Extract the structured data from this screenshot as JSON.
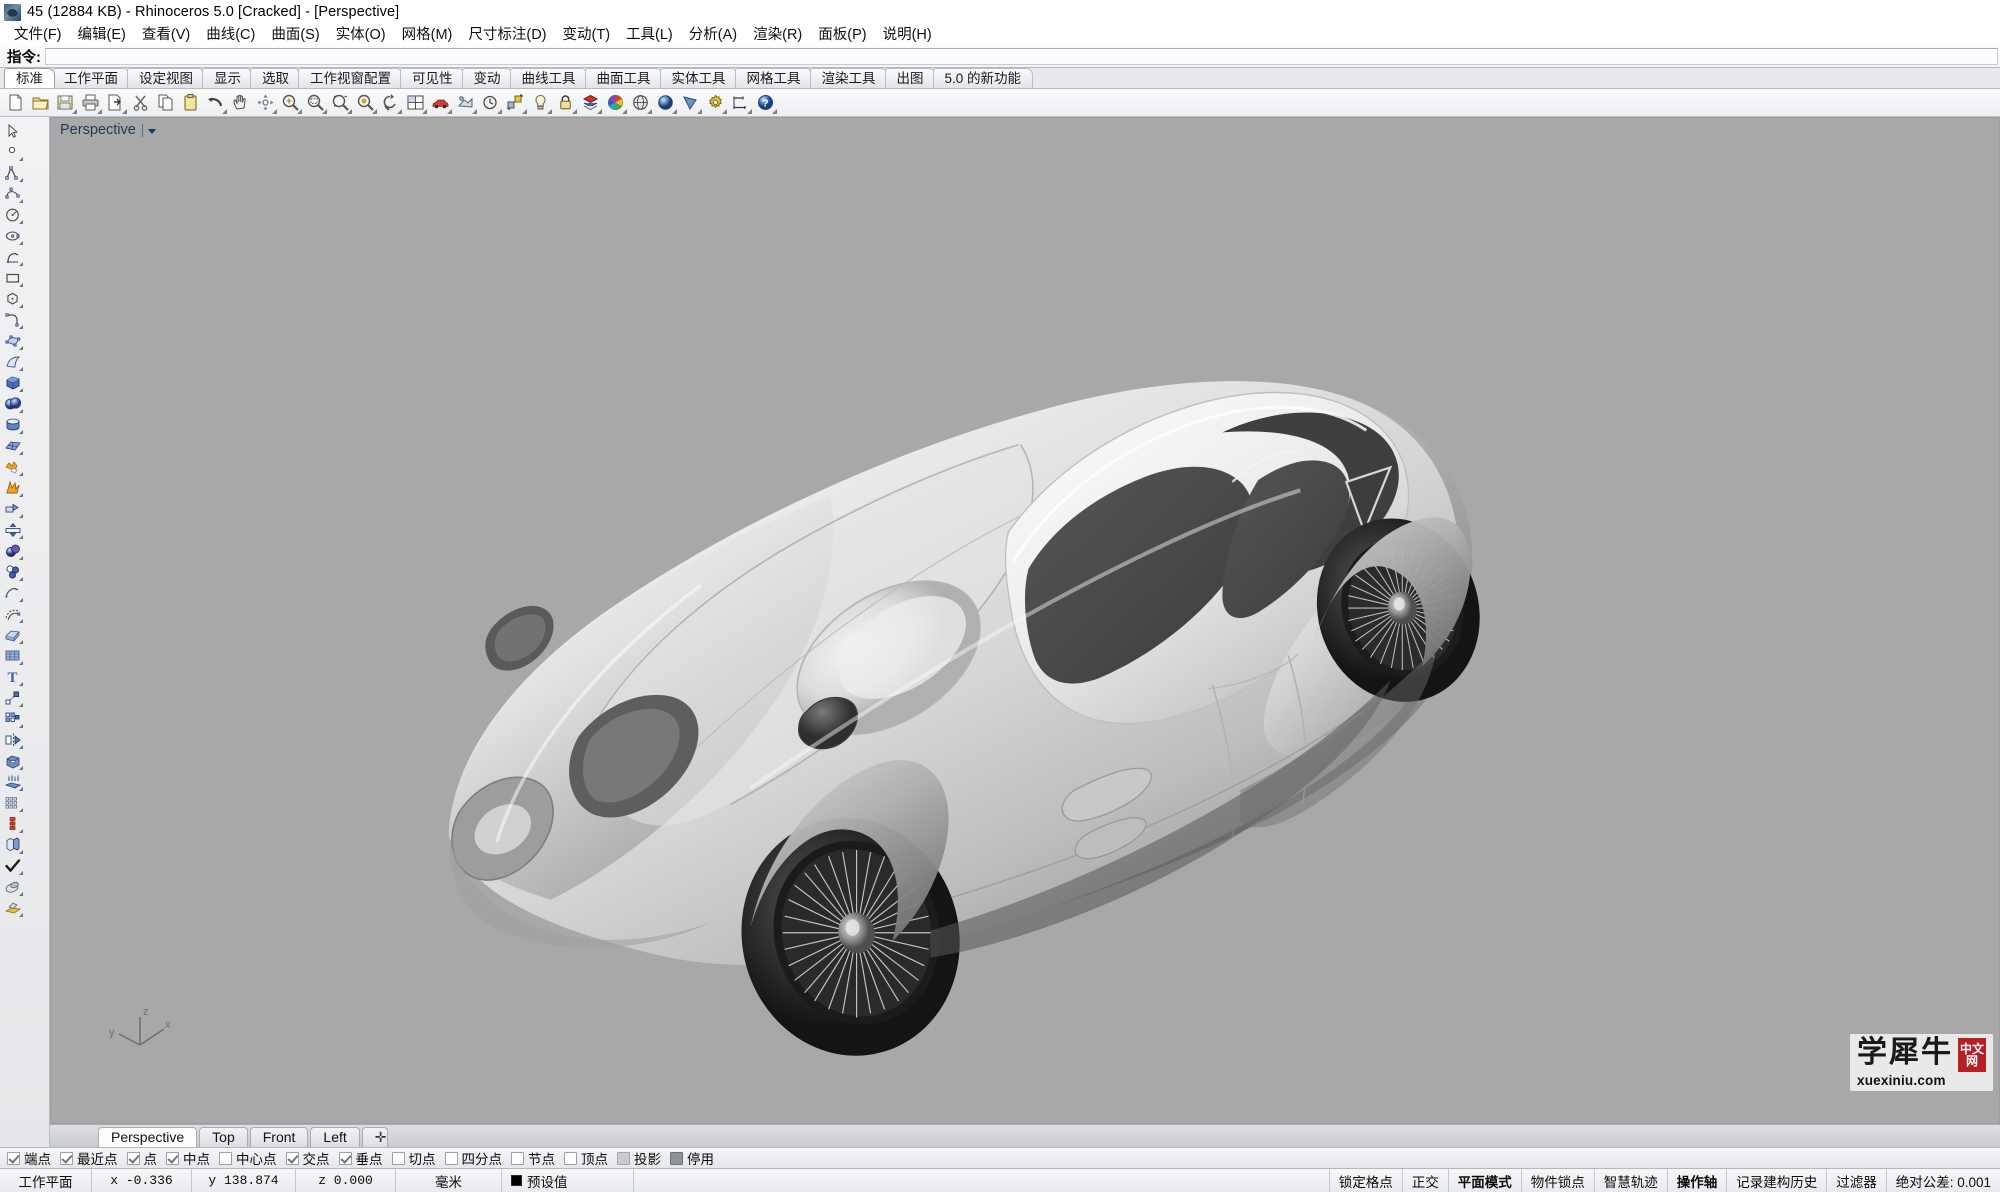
{
  "window": {
    "title": "45 (12884 KB) - Rhinoceros 5.0 [Cracked] - [Perspective]",
    "app_icon": "rhino-app-icon"
  },
  "menubar": {
    "items": [
      {
        "label": "文件(F)",
        "name": "menu-file"
      },
      {
        "label": "编辑(E)",
        "name": "menu-edit"
      },
      {
        "label": "查看(V)",
        "name": "menu-view"
      },
      {
        "label": "曲线(C)",
        "name": "menu-curve"
      },
      {
        "label": "曲面(S)",
        "name": "menu-surface"
      },
      {
        "label": "实体(O)",
        "name": "menu-solid"
      },
      {
        "label": "网格(M)",
        "name": "menu-mesh"
      },
      {
        "label": "尺寸标注(D)",
        "name": "menu-dimension"
      },
      {
        "label": "变动(T)",
        "name": "menu-transform"
      },
      {
        "label": "工具(L)",
        "name": "menu-tools"
      },
      {
        "label": "分析(A)",
        "name": "menu-analyze"
      },
      {
        "label": "渲染(R)",
        "name": "menu-render"
      },
      {
        "label": "面板(P)",
        "name": "menu-panels"
      },
      {
        "label": "说明(H)",
        "name": "menu-help"
      }
    ]
  },
  "command": {
    "label": "指令:",
    "value": "",
    "placeholder": ""
  },
  "toolbar_tabs": {
    "active_index": 0,
    "items": [
      {
        "label": "标准"
      },
      {
        "label": "工作平面"
      },
      {
        "label": "设定视图"
      },
      {
        "label": "显示"
      },
      {
        "label": "选取"
      },
      {
        "label": "工作视窗配置"
      },
      {
        "label": "可见性"
      },
      {
        "label": "变动"
      },
      {
        "label": "曲线工具"
      },
      {
        "label": "曲面工具"
      },
      {
        "label": "实体工具"
      },
      {
        "label": "网格工具"
      },
      {
        "label": "渲染工具"
      },
      {
        "label": "出图"
      },
      {
        "label": "5.0 的新功能"
      }
    ]
  },
  "icon_toolbar": {
    "buttons": [
      {
        "icon": "new-file-icon",
        "tip": "新建"
      },
      {
        "icon": "open-folder-icon",
        "tip": "打开"
      },
      {
        "icon": "save-disk-icon",
        "tip": "保存"
      },
      {
        "icon": "print-icon",
        "tip": "打印"
      },
      {
        "icon": "export-icon",
        "tip": "导出"
      },
      {
        "icon": "cut-scissors-icon",
        "tip": "剪切"
      },
      {
        "icon": "copy-icon",
        "tip": "复制"
      },
      {
        "icon": "paste-clipboard-icon",
        "tip": "粘贴"
      },
      {
        "icon": "undo-arrow-icon",
        "tip": "撤销"
      },
      {
        "icon": "pan-hand-icon",
        "tip": "平移"
      },
      {
        "icon": "zoom-extents-icon",
        "tip": "缩放至范围"
      },
      {
        "icon": "zoom-in-icon",
        "tip": "放大"
      },
      {
        "icon": "zoom-window-icon",
        "tip": "窗口缩放"
      },
      {
        "icon": "zoom-selected-icon",
        "tip": "缩放至选取物件"
      },
      {
        "icon": "zoom-target-icon",
        "tip": "目标缩放"
      },
      {
        "icon": "rotate-view-icon",
        "tip": "旋转视图"
      },
      {
        "icon": "viewport-layout-icon",
        "tip": "工作视窗配置"
      },
      {
        "icon": "car-render-icon",
        "tip": "渲染"
      },
      {
        "icon": "shaded-view-icon",
        "tip": "着色模式"
      },
      {
        "icon": "clock-history-icon",
        "tip": "建构历史"
      },
      {
        "icon": "named-views-icon",
        "tip": "命名视图"
      },
      {
        "icon": "light-bulb-icon",
        "tip": "灯光"
      },
      {
        "icon": "lock-icon",
        "tip": "锁定"
      },
      {
        "icon": "layers-icon",
        "tip": "图层"
      },
      {
        "icon": "color-wheel-icon",
        "tip": "颜色"
      },
      {
        "icon": "sphere-wire-icon",
        "tip": "线框模式"
      },
      {
        "icon": "sphere-shade-icon",
        "tip": "着色"
      },
      {
        "icon": "sphere-ghost-icon",
        "tip": "半透明"
      },
      {
        "icon": "sphere-render-icon",
        "tip": "渲染模式"
      },
      {
        "icon": "cone-icon",
        "tip": "显示模式"
      },
      {
        "icon": "gear-icon",
        "tip": "选项"
      },
      {
        "icon": "dimension-icon",
        "tip": "尺寸标注"
      },
      {
        "icon": "help-question-icon",
        "tip": "说明"
      }
    ]
  },
  "side_toolbar": {
    "buttons": [
      {
        "icon": "arrow-select-icon"
      },
      {
        "icon": "point-icon"
      },
      {
        "icon": "polyline-icon"
      },
      {
        "icon": "control-point-curve-icon"
      },
      {
        "icon": "circle-icon"
      },
      {
        "icon": "ellipse-icon"
      },
      {
        "icon": "arc-icon"
      },
      {
        "icon": "rectangle-icon"
      },
      {
        "icon": "polygon-icon"
      },
      {
        "icon": "curve-fillet-icon"
      },
      {
        "icon": "surface-cp-icon"
      },
      {
        "icon": "surface-sweep-icon"
      },
      {
        "icon": "box-icon"
      },
      {
        "icon": "sphere-boolean-icon"
      },
      {
        "icon": "cylinder-icon"
      },
      {
        "icon": "mesh-icon"
      },
      {
        "icon": "explode-icon"
      },
      {
        "icon": "boolean-union-icon"
      },
      {
        "icon": "trim-icon"
      },
      {
        "icon": "split-icon"
      },
      {
        "icon": "boolean-difference-icon"
      },
      {
        "icon": "boolean-intersect-icon"
      },
      {
        "icon": "curve-blend-icon"
      },
      {
        "icon": "curve-offset-icon"
      },
      {
        "icon": "surface-extrude-icon"
      },
      {
        "icon": "surface-loft-icon"
      },
      {
        "icon": "text-tool-icon"
      },
      {
        "icon": "scale-icon"
      },
      {
        "icon": "array-icon"
      },
      {
        "icon": "mirror-icon"
      },
      {
        "icon": "cap-holes-icon"
      },
      {
        "icon": "extract-surface-icon"
      },
      {
        "icon": "grid-array-icon"
      },
      {
        "icon": "analyze-direction-icon"
      },
      {
        "icon": "copy-objects-icon"
      },
      {
        "icon": "check-object-icon"
      },
      {
        "icon": "render-mesh-icon"
      },
      {
        "icon": "material-icon"
      }
    ]
  },
  "viewport": {
    "label": "Perspective",
    "background_color": "#a8a8a8",
    "axis_gizmo": {
      "x": "x",
      "y": "y",
      "z": "z"
    },
    "model": {
      "name": "classic-sports-car-3d-model",
      "description": "白色渲染的经典跑车三维模型 (Jaguar D-Type 风格)",
      "shading": "渲染模式"
    }
  },
  "viewport_tabs": {
    "active_index": 0,
    "items": [
      {
        "label": "Perspective"
      },
      {
        "label": "Top"
      },
      {
        "label": "Front"
      },
      {
        "label": "Left"
      }
    ],
    "add_label": "✛"
  },
  "osnap_bar": {
    "items": [
      {
        "label": "端点",
        "checked": true
      },
      {
        "label": "最近点",
        "checked": true
      },
      {
        "label": "点",
        "checked": true
      },
      {
        "label": "中点",
        "checked": true
      },
      {
        "label": "中心点",
        "checked": false
      },
      {
        "label": "交点",
        "checked": true
      },
      {
        "label": "垂点",
        "checked": true
      },
      {
        "label": "切点",
        "checked": false
      },
      {
        "label": "四分点",
        "checked": false
      },
      {
        "label": "节点",
        "checked": false
      },
      {
        "label": "顶点",
        "checked": false
      },
      {
        "label": "投影",
        "checked": false,
        "state": "grey"
      },
      {
        "label": "停用",
        "checked": false,
        "state": "slate"
      }
    ]
  },
  "status_bar": {
    "cplane_label": "工作平面",
    "coord_x": "x -0.336",
    "coord_y": "y 138.874",
    "coord_z": "z 0.000",
    "units": "毫米",
    "layer": "预设值",
    "layer_color": "#000000",
    "grid_snap": "锁定格点",
    "ortho": "正交",
    "planar": "平面模式",
    "osnap": "物件锁点",
    "smart_track": "智慧轨迹",
    "gumball": "操作轴",
    "record_history": "记录建构历史",
    "filter": "过滤器",
    "tolerance": "绝对公差: 0.001"
  },
  "watermark": {
    "brand_cn": "学犀牛",
    "badge_line1": "中文",
    "badge_line2": "网",
    "url": "xuexiniu.com"
  }
}
